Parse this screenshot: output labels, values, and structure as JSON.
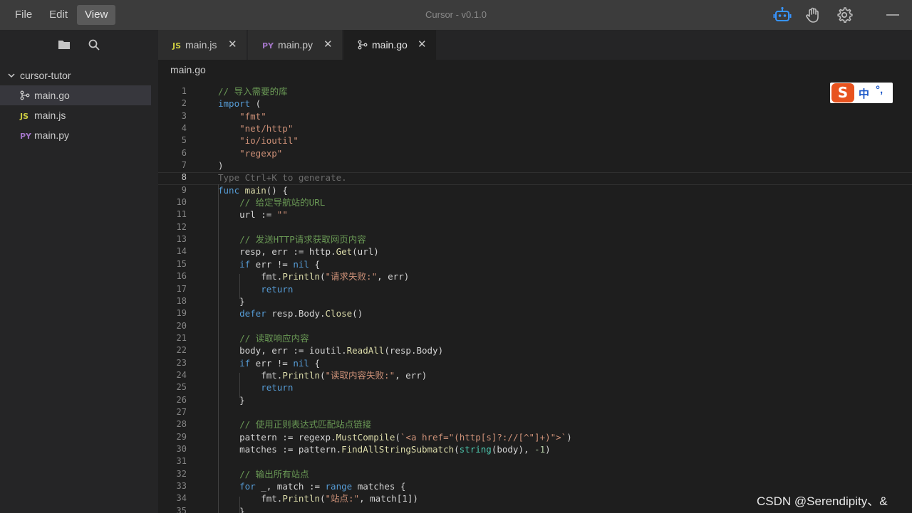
{
  "menu": {
    "file": "File",
    "edit": "Edit",
    "view": "View"
  },
  "app_title": "Cursor - v0.1.0",
  "titlebar_icons": [
    "robot-icon",
    "hand-icon",
    "gear-icon",
    "minimize-icon"
  ],
  "sidebar": {
    "actions": [
      "folder-icon",
      "search-icon"
    ],
    "root": "cursor-tutor",
    "files": [
      {
        "icon": "go-file-icon",
        "label": "main.go"
      },
      {
        "icon_text": "JS",
        "label": "main.js"
      },
      {
        "icon_text": "PY",
        "label": "main.py"
      }
    ]
  },
  "tabs": [
    {
      "icon_text": "JS",
      "label": "main.js",
      "close": "✕"
    },
    {
      "icon_text": "PY",
      "label": "main.py",
      "close": "✕"
    },
    {
      "icon": "go-file-icon",
      "label": "main.go",
      "close": "✕"
    }
  ],
  "breadcrumb": "main.go",
  "editor": {
    "current_line": "8",
    "line_numbers": [
      "1",
      "2",
      "3",
      "4",
      "5",
      "6",
      "7",
      "8",
      "9",
      "10",
      "11",
      "12",
      "13",
      "14",
      "15",
      "16",
      "17",
      "18",
      "19",
      "20",
      "21",
      "22",
      "23",
      "24",
      "25",
      "26",
      "27",
      "28",
      "29",
      "30",
      "31",
      "32",
      "33",
      "34",
      "35"
    ],
    "lines": [
      [
        [
          "com",
          "// 导入需要的库"
        ]
      ],
      [
        [
          "kw",
          "import"
        ],
        [
          "var",
          " ("
        ]
      ],
      [
        [
          "str",
          "    \"fmt\""
        ]
      ],
      [
        [
          "str",
          "    \"net/http\""
        ]
      ],
      [
        [
          "str",
          "    \"io/ioutil\""
        ]
      ],
      [
        [
          "str",
          "    \"regexp\""
        ]
      ],
      [
        [
          "var",
          ")"
        ]
      ],
      [
        [
          "ph",
          "Type Ctrl+K to generate."
        ]
      ],
      [
        [
          "kw",
          "func"
        ],
        [
          "var",
          " "
        ],
        [
          "fn",
          "main"
        ],
        [
          "var",
          "() {"
        ]
      ],
      [
        [
          "com",
          "    // 给定导航站的URL"
        ]
      ],
      [
        [
          "var",
          "    url := "
        ],
        [
          "str",
          "\"\""
        ]
      ],
      [
        [
          "var",
          ""
        ]
      ],
      [
        [
          "com",
          "    // 发送HTTP请求获取网页内容"
        ]
      ],
      [
        [
          "var",
          "    resp, err := http."
        ],
        [
          "fn",
          "Get"
        ],
        [
          "var",
          "(url)"
        ]
      ],
      [
        [
          "ctl",
          "    if"
        ],
        [
          "var",
          " err != "
        ],
        [
          "kw",
          "nil"
        ],
        [
          "var",
          " {"
        ]
      ],
      [
        [
          "var",
          "        fmt."
        ],
        [
          "fn",
          "Println"
        ],
        [
          "var",
          "("
        ],
        [
          "str",
          "\"请求失败:\""
        ],
        [
          "var",
          ", err)"
        ]
      ],
      [
        [
          "ctl",
          "        return"
        ]
      ],
      [
        [
          "var",
          "    }"
        ]
      ],
      [
        [
          "ctl",
          "    defer"
        ],
        [
          "var",
          " resp.Body."
        ],
        [
          "fn",
          "Close"
        ],
        [
          "var",
          "()"
        ]
      ],
      [
        [
          "var",
          ""
        ]
      ],
      [
        [
          "com",
          "    // 读取响应内容"
        ]
      ],
      [
        [
          "var",
          "    body, err := ioutil."
        ],
        [
          "fn",
          "ReadAll"
        ],
        [
          "var",
          "(resp.Body)"
        ]
      ],
      [
        [
          "ctl",
          "    if"
        ],
        [
          "var",
          " err != "
        ],
        [
          "kw",
          "nil"
        ],
        [
          "var",
          " {"
        ]
      ],
      [
        [
          "var",
          "        fmt."
        ],
        [
          "fn",
          "Println"
        ],
        [
          "var",
          "("
        ],
        [
          "str",
          "\"读取内容失败:\""
        ],
        [
          "var",
          ", err)"
        ]
      ],
      [
        [
          "ctl",
          "        return"
        ]
      ],
      [
        [
          "var",
          "    }"
        ]
      ],
      [
        [
          "var",
          ""
        ]
      ],
      [
        [
          "com",
          "    // 使用正则表达式匹配站点链接"
        ]
      ],
      [
        [
          "var",
          "    pattern := regexp."
        ],
        [
          "fn",
          "MustCompile"
        ],
        [
          "var",
          "("
        ],
        [
          "str",
          "`<a href=\"(http[s]?://[^\"]+)\">`"
        ],
        [
          "var",
          ")"
        ]
      ],
      [
        [
          "var",
          "    matches := pattern."
        ],
        [
          "fn",
          "FindAllStringSubmatch"
        ],
        [
          "var",
          "("
        ],
        [
          "ty",
          "string"
        ],
        [
          "var",
          "(body), "
        ],
        [
          "num",
          "-1"
        ],
        [
          "var",
          ")"
        ]
      ],
      [
        [
          "var",
          ""
        ]
      ],
      [
        [
          "com",
          "    // 输出所有站点"
        ]
      ],
      [
        [
          "ctl",
          "    for"
        ],
        [
          "var",
          " _, match := "
        ],
        [
          "ctl",
          "range"
        ],
        [
          "var",
          " matches {"
        ]
      ],
      [
        [
          "var",
          "        fmt."
        ],
        [
          "fn",
          "Println"
        ],
        [
          "var",
          "("
        ],
        [
          "str",
          "\"站点:\""
        ],
        [
          "var",
          ", match[1])"
        ]
      ],
      [
        [
          "var",
          "    }"
        ]
      ]
    ]
  },
  "ime": {
    "logo": "S",
    "mode": "中",
    "punct": "°,"
  },
  "watermark": "CSDN @Serendipity、&",
  "colors": {
    "accent_robot": "#3794ff",
    "ime_logo": "#e8531f",
    "ime_text": "#1a57c8"
  }
}
